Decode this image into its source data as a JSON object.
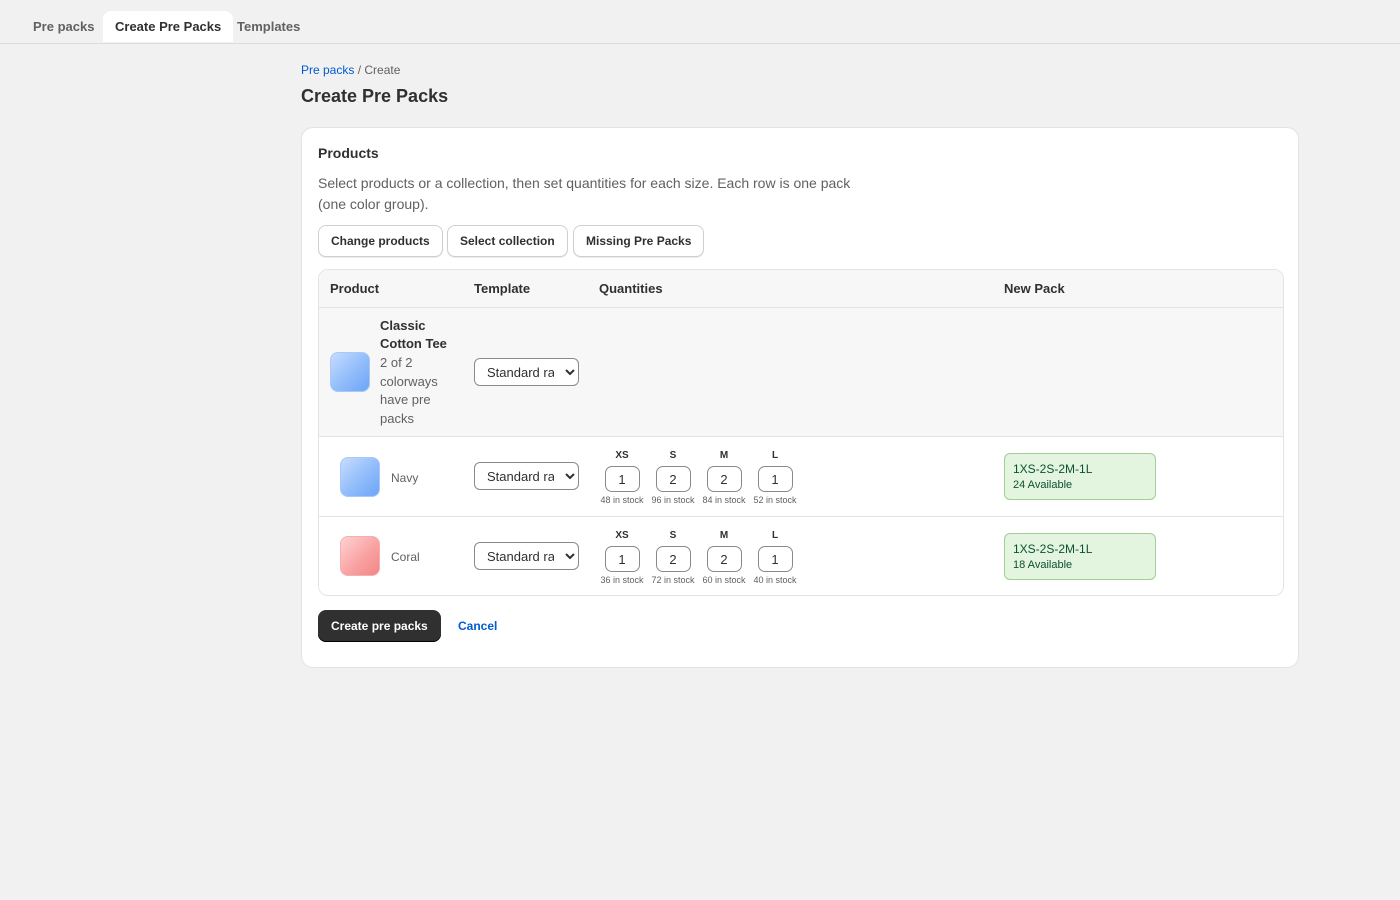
{
  "tabs": [
    {
      "label": "Pre packs",
      "active": false
    },
    {
      "label": "Create Pre Packs",
      "active": true
    },
    {
      "label": "Templates",
      "active": false
    }
  ],
  "breadcrumb": {
    "parent": "Pre packs",
    "separator": " / ",
    "current": "Create"
  },
  "page_title": "Create Pre Packs",
  "card": {
    "title": "Products",
    "description": "Select products or a collection, then set quantities for each size. Each row is one pack (one color group).",
    "buttons": {
      "change_products": "Change products",
      "select_collection": "Select collection",
      "missing_pre_packs": "Missing Pre Packs"
    }
  },
  "table": {
    "headers": {
      "product": "Product",
      "template": "Template",
      "quantities": "Quantities",
      "new_pack": "New Pack"
    },
    "parent": {
      "name": "Classic Cotton Tee",
      "meta": "2 of 2 colorways have pre packs",
      "template": "Standard ratio",
      "swatch_color": "#90bcfa"
    },
    "variants": [
      {
        "name": "Navy",
        "swatch_color": "#90bcfa",
        "template": "Standard ratio",
        "sizes": [
          {
            "label": "XS",
            "qty": "1",
            "stock": "48 in stock"
          },
          {
            "label": "S",
            "qty": "2",
            "stock": "96 in stock"
          },
          {
            "label": "M",
            "qty": "2",
            "stock": "84 in stock"
          },
          {
            "label": "L",
            "qty": "1",
            "stock": "52 in stock"
          }
        ],
        "pack": {
          "code": "1XS-2S-2M-1L",
          "available": "24 Available"
        }
      },
      {
        "name": "Coral",
        "swatch_color": "#f9a3a3",
        "template": "Standard ratio",
        "sizes": [
          {
            "label": "XS",
            "qty": "1",
            "stock": "36 in stock"
          },
          {
            "label": "S",
            "qty": "2",
            "stock": "72 in stock"
          },
          {
            "label": "M",
            "qty": "2",
            "stock": "60 in stock"
          },
          {
            "label": "L",
            "qty": "1",
            "stock": "40 in stock"
          }
        ],
        "pack": {
          "code": "1XS-2S-2M-1L",
          "available": "18 Available"
        }
      }
    ]
  },
  "actions": {
    "primary": "Create pre packs",
    "cancel": "Cancel"
  },
  "colors": {
    "accent_link": "#005bd3",
    "primary_button": "#303030",
    "badge_bg": "#e3f4df",
    "badge_text": "#0c5132"
  }
}
